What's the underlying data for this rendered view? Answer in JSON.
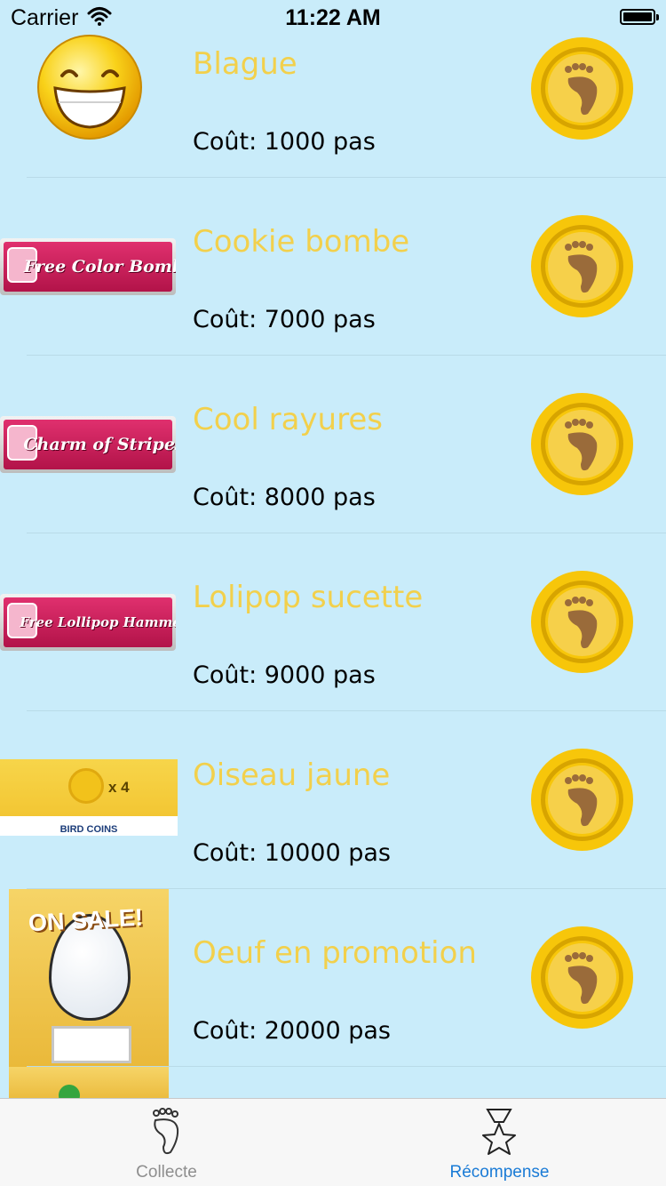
{
  "status_bar": {
    "carrier": "Carrier",
    "time": "11:22 AM"
  },
  "rewards": [
    {
      "title": "Blague",
      "cost": "Coût: 1000 pas",
      "image": "smiley-face"
    },
    {
      "title": "Cookie bombe",
      "cost": "Coût: 7000 pas",
      "image": "free-color-bomb-banner",
      "image_text": "Free Color Bomb"
    },
    {
      "title": "Cool rayures",
      "cost": "Coût: 8000 pas",
      "image": "charm-of-stripes-banner",
      "image_text": "Charm of Stripes"
    },
    {
      "title": "Lolipop sucette",
      "cost": "Coût: 9000 pas",
      "image": "free-lollipop-hammer-banner",
      "image_text": "Free Lollipop Hammer"
    },
    {
      "title": "Oiseau jaune",
      "cost": "Coût: 10000 pas",
      "image": "bird-coins",
      "image_text": "x 4",
      "image_caption": "BIRD COINS"
    },
    {
      "title": "Oeuf en promotion",
      "cost": "Coût: 20000 pas",
      "image": "egg-on-sale",
      "image_text": "ON SALE!"
    }
  ],
  "coin_button_icon": "footprint-coin-icon",
  "tab_bar": {
    "tabs": [
      {
        "label": "Collecte",
        "icon": "footprint-icon",
        "selected": false
      },
      {
        "label": "Récompense",
        "icon": "star-trophy-icon",
        "selected": true
      }
    ]
  },
  "colors": {
    "background": "#c9ecfa",
    "title_yellow": "#f2d04c",
    "coin_gold": "#f7c60a",
    "tab_active": "#1a7bd6",
    "tab_inactive": "#8e8e8e"
  }
}
